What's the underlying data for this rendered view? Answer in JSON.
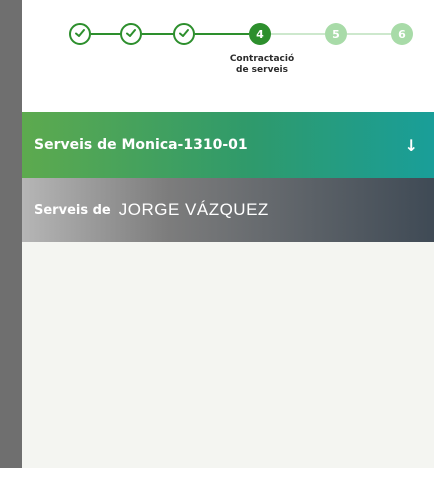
{
  "stepper": {
    "steps": [
      {
        "label": "",
        "state": "done"
      },
      {
        "label": "",
        "state": "done"
      },
      {
        "label": "",
        "state": "done"
      },
      {
        "label": "4",
        "state": "current"
      },
      {
        "label": "5",
        "state": "pending"
      },
      {
        "label": "6",
        "state": "pending"
      }
    ],
    "current_caption_line1": "Contractació",
    "current_caption_line2": "de serveis"
  },
  "services_bar": {
    "label": "Serveis de Monica-1310-01",
    "arrow": "↓"
  },
  "owner_bar": {
    "prefix": "Serveis de",
    "name": "JORGE VÁZQUEZ"
  },
  "colors": {
    "step_green": "#2d8f2d",
    "step_pending": "#a8dba8",
    "bar_green_start": "#5daa4e",
    "bar_green_end": "#199e99",
    "bar_dark_end": "#3f4a55"
  }
}
